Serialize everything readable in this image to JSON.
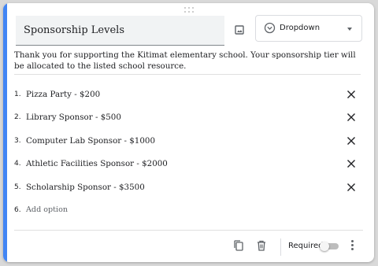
{
  "question": {
    "title": "Sponsorship Levels",
    "type_label": "Dropdown",
    "description": "Thank you for supporting the Kitimat elementary school. Your sponsorship tier will be allocated to the listed school resource."
  },
  "options": [
    {
      "num": "1.",
      "label": "Pizza Party - $200"
    },
    {
      "num": "2.",
      "label": "Library Sponsor - $500"
    },
    {
      "num": "3.",
      "label": "Computer Lab Sponsor - $1000"
    },
    {
      "num": "4.",
      "label": "Athletic Facilities Sponsor - $2000"
    },
    {
      "num": "5.",
      "label": "Scholarship Sponsor - $3500"
    }
  ],
  "add_option": {
    "num": "6.",
    "label": "Add option"
  },
  "footer": {
    "required_label": "Required",
    "required_on": false
  },
  "colors": {
    "accent": "#4285f4",
    "background": "#d9d9d9"
  },
  "icons": [
    "drag-handle-icon",
    "image-icon",
    "dropdown-type-icon",
    "close-icon",
    "duplicate-icon",
    "trash-icon",
    "more-vert-icon"
  ]
}
